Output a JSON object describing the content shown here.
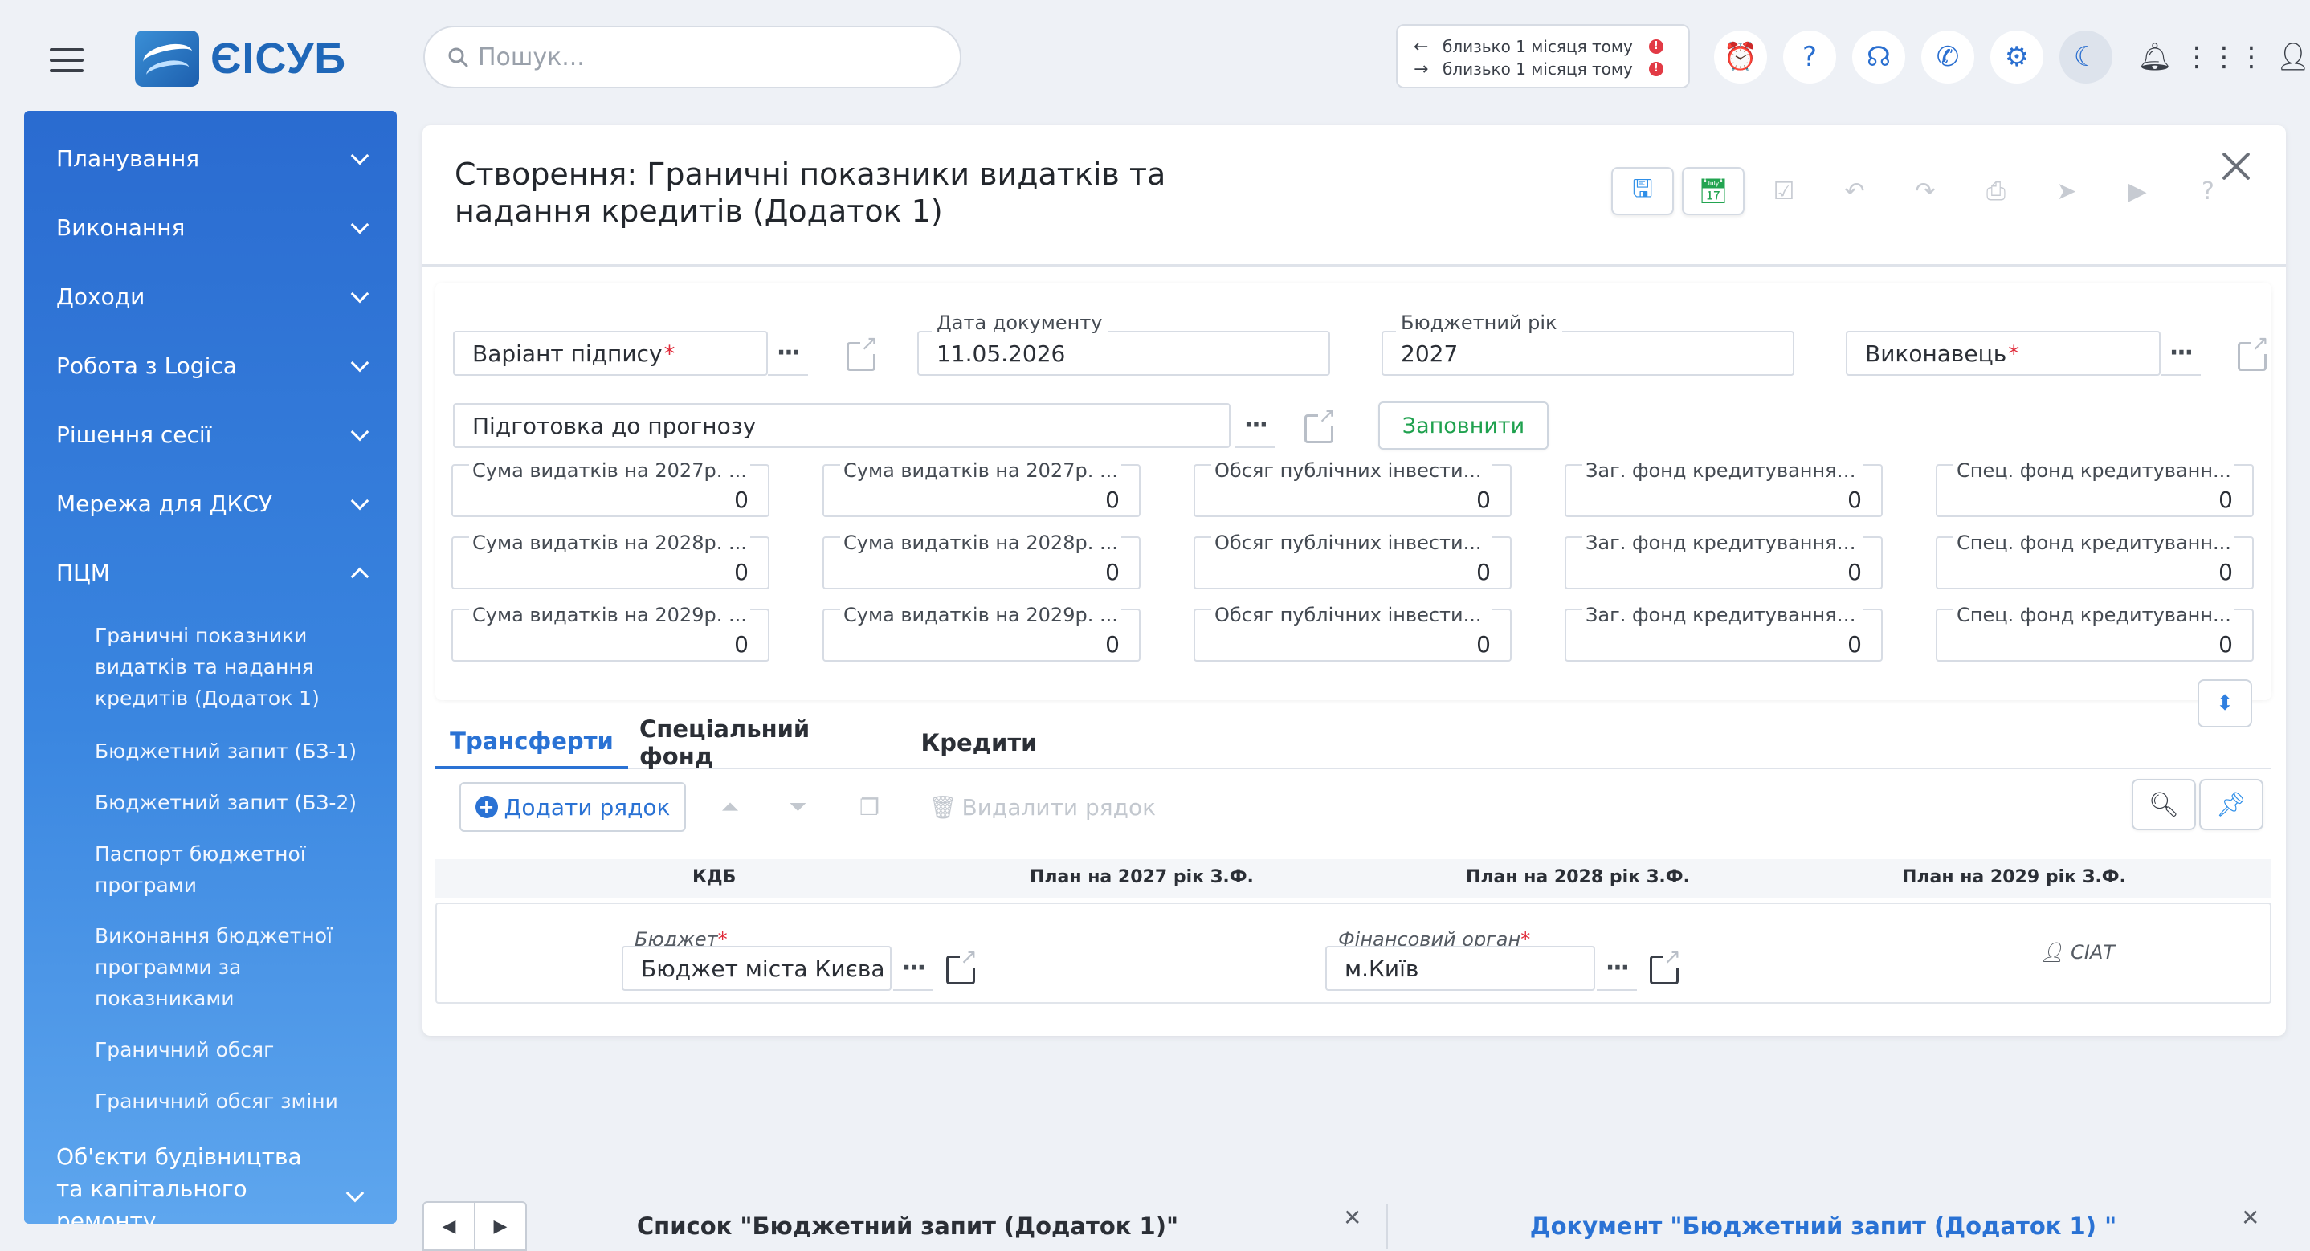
{
  "app": {
    "logo_text": "ЄІСУБ",
    "search_placeholder": "Пошук..."
  },
  "notifications": [
    {
      "direction": "←",
      "text": "близько 1 місяця тому"
    },
    {
      "direction": "→",
      "text": "близько 1 місяця тому"
    }
  ],
  "top_icons": [
    "alarm-clock-icon",
    "help-icon",
    "headset-icon",
    "phone-icon",
    "gear-icon",
    "moon-icon",
    "bell-icon",
    "apps-grid-icon",
    "user-icon"
  ],
  "sidebar": {
    "items": [
      {
        "label": "Планування"
      },
      {
        "label": "Виконання"
      },
      {
        "label": "Доходи"
      },
      {
        "label": "Робота з Logica"
      },
      {
        "label": "Рішення сесії"
      },
      {
        "label": "Мережа для ДКСУ"
      },
      {
        "label": "ПЦМ"
      },
      {
        "label": "Об'єкти будівництва та капітального ремонту"
      }
    ],
    "subitems": [
      {
        "label": "Граничні показники видатків та надання кредитів (Додаток 1)"
      },
      {
        "label": "Бюджетний запит (БЗ-1)"
      },
      {
        "label": "Бюджетний запит (БЗ-2)"
      },
      {
        "label": "Паспорт бюджетної програми"
      },
      {
        "label": "Виконання бюджетної программи за показниками"
      },
      {
        "label": "Граничний обсяг"
      },
      {
        "label": "Граничний обсяг зміни"
      }
    ]
  },
  "document": {
    "title": "Створення: Граничні показники видатків та надання кредитів (Додаток 1)"
  },
  "form": {
    "signature_variant": "Варіант підпису",
    "doc_date_label": "Дата документу",
    "doc_date_value": "11.05.2026",
    "budget_year_label": "Бюджетний рік",
    "budget_year_value": "2027",
    "executor": "Виконавець",
    "forecast_prep": "Підготовка до прогнозу",
    "fill_button": "Заповнити",
    "numeric_fields": [
      [
        {
          "label": "Сума видатків на 2027р. ...",
          "value": "0"
        },
        {
          "label": "Сума видатків на 2027р. ...",
          "value": "0"
        },
        {
          "label": "Обсяг публічних інвести...",
          "value": "0"
        },
        {
          "label": "Заг. фонд кредитування ...",
          "value": "0"
        },
        {
          "label": "Спец. фонд кредитуванн...",
          "value": "0"
        }
      ],
      [
        {
          "label": "Сума видатків на 2028р. ...",
          "value": "0"
        },
        {
          "label": "Сума видатків на 2028р. ...",
          "value": "0"
        },
        {
          "label": "Обсяг публічних інвести...",
          "value": "0"
        },
        {
          "label": "Заг. фонд кредитування ...",
          "value": "0"
        },
        {
          "label": "Спец. фонд кредитуванн...",
          "value": "0"
        }
      ],
      [
        {
          "label": "Сума видатків на 2029р. ...",
          "value": "0"
        },
        {
          "label": "Сума видатків на 2029р. ...",
          "value": "0"
        },
        {
          "label": "Обсяг публічних інвести...",
          "value": "0"
        },
        {
          "label": "Заг. фонд кредитування ...",
          "value": "0"
        },
        {
          "label": "Спец. фонд кредитуванн...",
          "value": "0"
        }
      ]
    ]
  },
  "tabs": [
    {
      "label": "Трансферти",
      "active": true
    },
    {
      "label": "Спеціальний фонд",
      "active": false
    },
    {
      "label": "Кредити",
      "active": false
    }
  ],
  "grid": {
    "add_row": "Додати рядок",
    "delete_row": "Видалити рядок",
    "headers": {
      "kdb": "КДБ",
      "plan_2027": "План на   2027   рік З.Ф.",
      "plan_2028": "План на   2028   рік З.Ф.",
      "plan_2029": "План на   2029   рік З.Ф."
    },
    "row": {
      "budget_label": "Бюджет",
      "budget_value": "Бюджет міста Києва",
      "fin_org_label": "Фінансовий орган",
      "fin_org_value": "м.Київ",
      "user": "СІАТ"
    }
  },
  "bottom_tabs": [
    {
      "label": "Список \"Бюджетний запит (Додаток 1)\"",
      "active": false
    },
    {
      "label": "Документ \"Бюджетний запит (Додаток 1) \"",
      "active": true
    }
  ],
  "colors": {
    "accent": "#2a72d4",
    "success": "#1fa14e",
    "required": "#e02b3a",
    "sidebar_top": "#2a6bd0",
    "sidebar_bottom": "#5ea6ee"
  }
}
